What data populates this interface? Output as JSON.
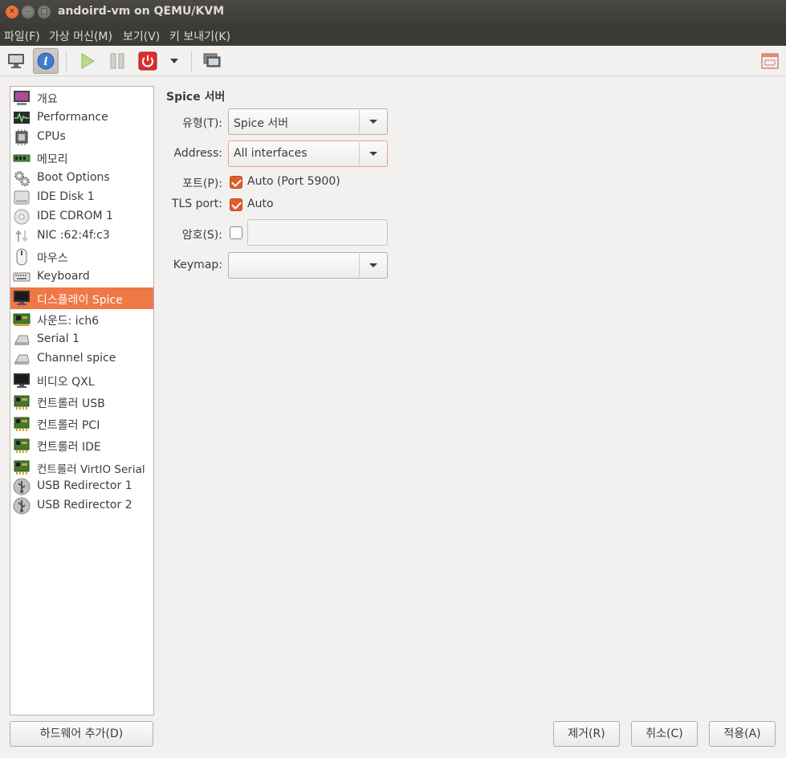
{
  "window": {
    "title": "andoird-vm on QEMU/KVM"
  },
  "menu": [
    {
      "label": "파일(F)"
    },
    {
      "label": "가상 머신(M)"
    },
    {
      "label": "보기(V)"
    },
    {
      "label": "키 보내기(K)"
    }
  ],
  "toolbar": {
    "icons": [
      "console-icon",
      "details-info-icon",
      "run-icon",
      "pause-icon",
      "shutdown-icon",
      "dropdown-arrow-icon",
      "snapshot-icon",
      "fullscreen-icon"
    ],
    "active": "details-info-icon"
  },
  "hardware_list": [
    {
      "label": "개요",
      "icon": "monitor-purple-icon"
    },
    {
      "label": "Performance",
      "icon": "performance-graph-icon"
    },
    {
      "label": "CPUs",
      "icon": "cpu-chip-icon"
    },
    {
      "label": "메모리",
      "icon": "memory-module-icon"
    },
    {
      "label": "Boot Options",
      "icon": "gears-icon"
    },
    {
      "label": "IDE Disk 1",
      "icon": "hard-disk-icon"
    },
    {
      "label": "IDE CDROM 1",
      "icon": "cdrom-icon"
    },
    {
      "label": "NIC :62:4f:c3",
      "icon": "network-arrows-icon"
    },
    {
      "label": "마우스",
      "icon": "mouse-icon"
    },
    {
      "label": "Keyboard",
      "icon": "keyboard-icon"
    },
    {
      "label": "디스플레이 Spice",
      "icon": "display-monitor-icon",
      "selected": true
    },
    {
      "label": "사운드: ich6",
      "icon": "sound-card-icon"
    },
    {
      "label": "Serial 1",
      "icon": "serial-port-icon"
    },
    {
      "label": "Channel spice",
      "icon": "channel-icon"
    },
    {
      "label": "비디오 QXL",
      "icon": "video-monitor-icon"
    },
    {
      "label": "컨트롤러 USB",
      "icon": "controller-card-icon"
    },
    {
      "label": "컨트롤러 PCI",
      "icon": "controller-card-icon"
    },
    {
      "label": "컨트롤러 IDE",
      "icon": "controller-card-icon"
    },
    {
      "label": "컨트롤러 VirtIO Serial",
      "icon": "controller-card-icon"
    },
    {
      "label": "USB Redirector 1",
      "icon": "usb-icon"
    },
    {
      "label": "USB Redirector 2",
      "icon": "usb-icon"
    }
  ],
  "detail": {
    "section_title": "Spice 서버",
    "type_label": "유형(T):",
    "type_value": "Spice 서버",
    "address_label": "Address:",
    "address_value": "All interfaces",
    "port_label": "포트(P):",
    "port_auto_checked": true,
    "port_auto_text": "Auto (Port 5900)",
    "tls_label": "TLS port:",
    "tls_auto_checked": true,
    "tls_auto_text": "Auto",
    "password_label": "암호(S):",
    "password_checked": false,
    "password_value": "",
    "keymap_label": "Keymap:",
    "keymap_value": ""
  },
  "buttons": {
    "add_hardware": "하드웨어 추가(D)",
    "remove": "제거(R)",
    "cancel": "취소(C)",
    "apply": "적용(A)"
  },
  "colors": {
    "accent": "#f07746",
    "checkbox": "#e05d2c",
    "titlebar": "#3c3b37"
  }
}
